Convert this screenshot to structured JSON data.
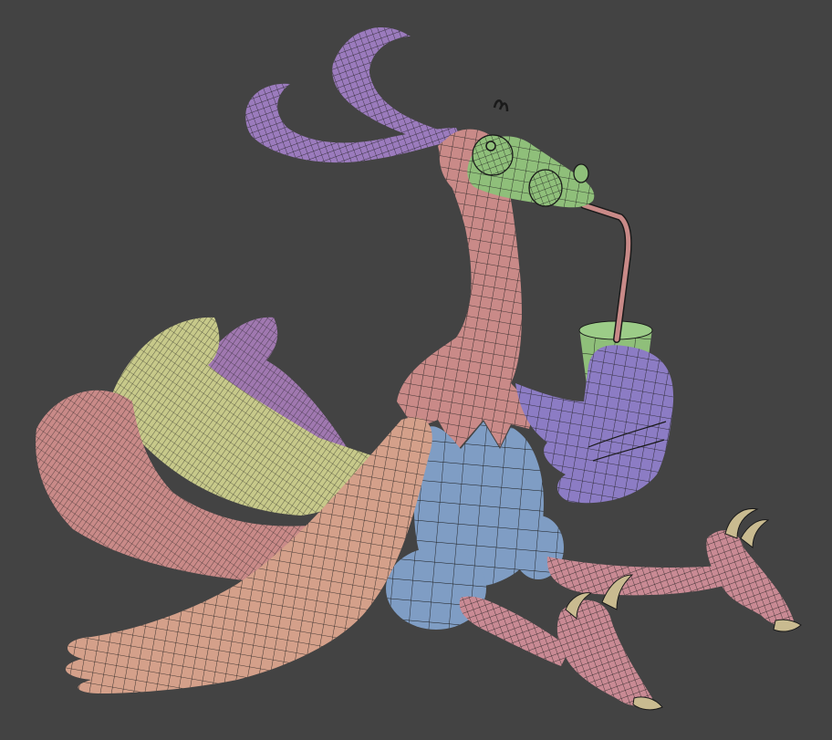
{
  "scene": {
    "background_color": "#434343",
    "wireframe_color": "#1a1a1a",
    "subject": "3d-cartoon-bird-wireframe-model",
    "materials": {
      "crest": "#9b7bbd",
      "head": "#8fbf7a",
      "neck_body": "#c98a88",
      "belly": "#7f9dc4",
      "wing_right": "#8c7cc4",
      "cup": "#8fbf7a",
      "tail_yellow": "#c7c98a",
      "tail_pink": "#c98a88",
      "tail_purple": "#a078b0",
      "front_wing": "#d4a08a",
      "legs": "#c98a94",
      "claws": "#c9bb90"
    }
  }
}
